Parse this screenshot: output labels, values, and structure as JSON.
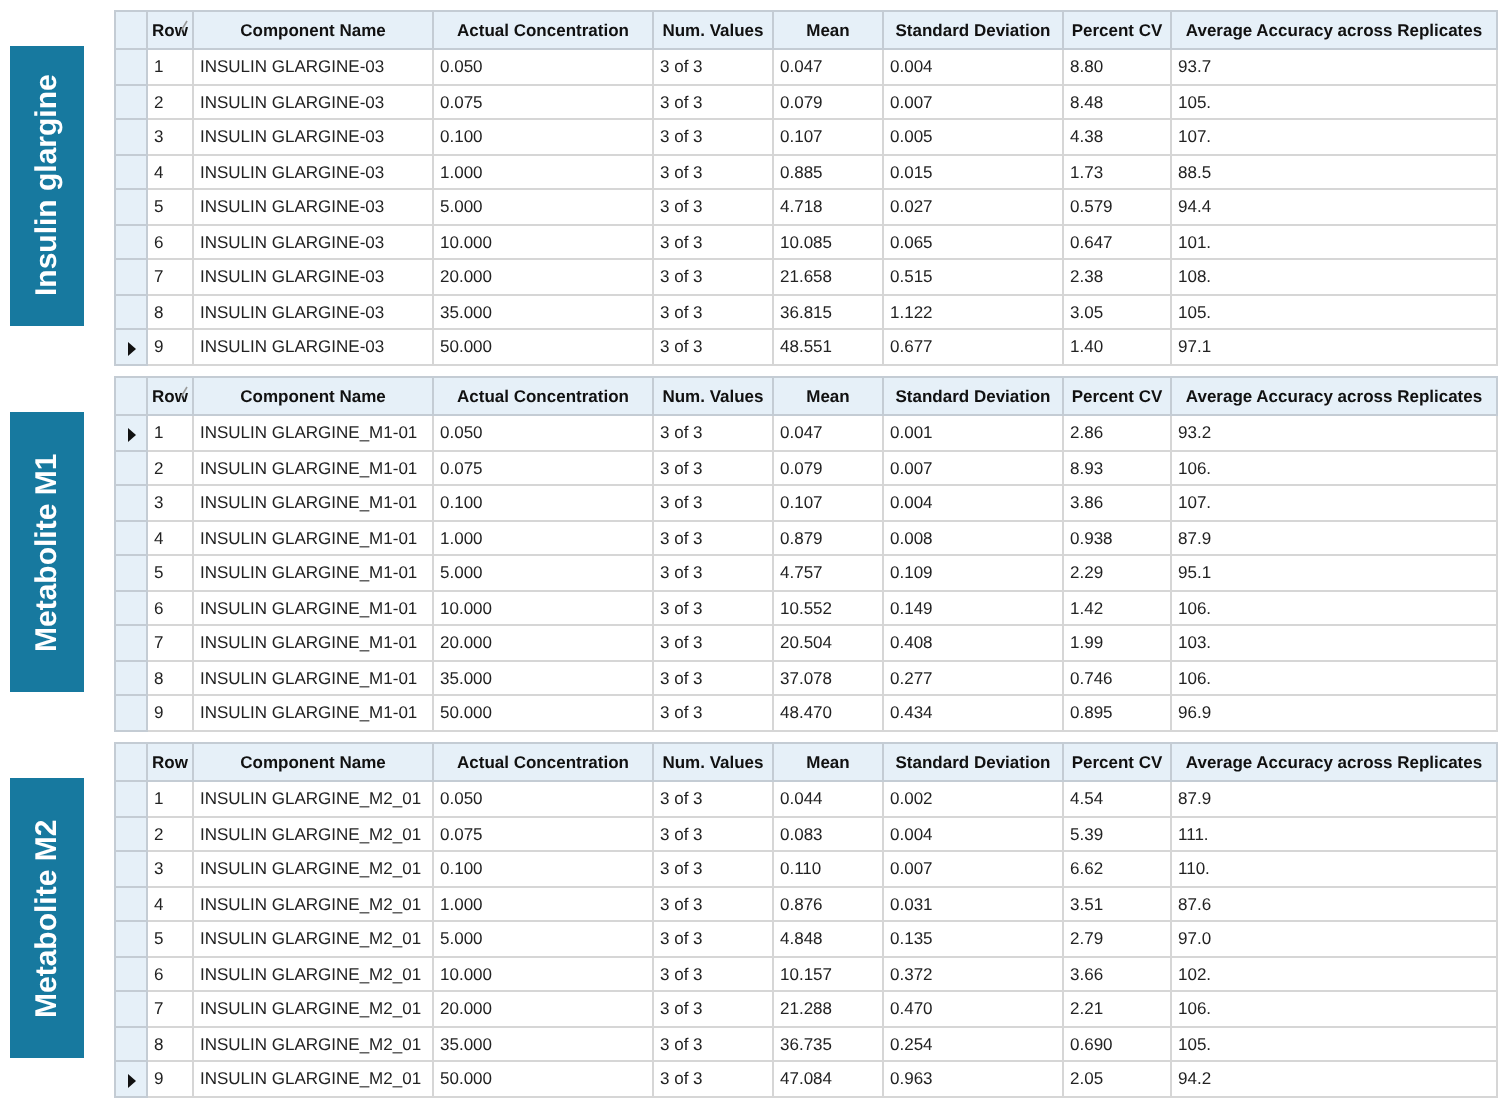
{
  "sections": [
    {
      "label": "Insulin glargine",
      "sorted": true,
      "columns": [
        "Row",
        "Component Name",
        "Actual Concentration",
        "Num. Values",
        "Mean",
        "Standard Deviation",
        "Percent CV",
        "Average Accuracy across Replicates"
      ],
      "rows": [
        {
          "current": false,
          "cells": [
            "1",
            "INSULIN GLARGINE-03",
            "0.050",
            "3 of 3",
            "0.047",
            "0.004",
            "8.80",
            "93.7"
          ]
        },
        {
          "current": false,
          "cells": [
            "2",
            "INSULIN GLARGINE-03",
            "0.075",
            "3 of 3",
            "0.079",
            "0.007",
            "8.48",
            "105."
          ]
        },
        {
          "current": false,
          "cells": [
            "3",
            "INSULIN GLARGINE-03",
            "0.100",
            "3 of 3",
            "0.107",
            "0.005",
            "4.38",
            "107."
          ]
        },
        {
          "current": false,
          "cells": [
            "4",
            "INSULIN GLARGINE-03",
            "1.000",
            "3 of 3",
            "0.885",
            "0.015",
            "1.73",
            "88.5"
          ]
        },
        {
          "current": false,
          "cells": [
            "5",
            "INSULIN GLARGINE-03",
            "5.000",
            "3 of 3",
            "4.718",
            "0.027",
            "0.579",
            "94.4"
          ]
        },
        {
          "current": false,
          "cells": [
            "6",
            "INSULIN GLARGINE-03",
            "10.000",
            "3 of 3",
            "10.085",
            "0.065",
            "0.647",
            "101."
          ]
        },
        {
          "current": false,
          "cells": [
            "7",
            "INSULIN GLARGINE-03",
            "20.000",
            "3 of 3",
            "21.658",
            "0.515",
            "2.38",
            "108."
          ]
        },
        {
          "current": false,
          "cells": [
            "8",
            "INSULIN GLARGINE-03",
            "35.000",
            "3 of 3",
            "36.815",
            "1.122",
            "3.05",
            "105."
          ]
        },
        {
          "current": true,
          "cells": [
            "9",
            "INSULIN GLARGINE-03",
            "50.000",
            "3 of 3",
            "48.551",
            "0.677",
            "1.40",
            "97.1"
          ]
        }
      ]
    },
    {
      "label": "Metabolite M1",
      "sorted": true,
      "columns": [
        "Row",
        "Component Name",
        "Actual Concentration",
        "Num. Values",
        "Mean",
        "Standard Deviation",
        "Percent CV",
        "Average Accuracy across Replicates"
      ],
      "rows": [
        {
          "current": true,
          "cells": [
            "1",
            "INSULIN GLARGINE_M1-01",
            "0.050",
            "3 of 3",
            "0.047",
            "0.001",
            "2.86",
            "93.2"
          ]
        },
        {
          "current": false,
          "cells": [
            "2",
            "INSULIN GLARGINE_M1-01",
            "0.075",
            "3 of 3",
            "0.079",
            "0.007",
            "8.93",
            "106."
          ]
        },
        {
          "current": false,
          "cells": [
            "3",
            "INSULIN GLARGINE_M1-01",
            "0.100",
            "3 of 3",
            "0.107",
            "0.004",
            "3.86",
            "107."
          ]
        },
        {
          "current": false,
          "cells": [
            "4",
            "INSULIN GLARGINE_M1-01",
            "1.000",
            "3 of 3",
            "0.879",
            "0.008",
            "0.938",
            "87.9"
          ]
        },
        {
          "current": false,
          "cells": [
            "5",
            "INSULIN GLARGINE_M1-01",
            "5.000",
            "3 of 3",
            "4.757",
            "0.109",
            "2.29",
            "95.1"
          ]
        },
        {
          "current": false,
          "cells": [
            "6",
            "INSULIN GLARGINE_M1-01",
            "10.000",
            "3 of 3",
            "10.552",
            "0.149",
            "1.42",
            "106."
          ]
        },
        {
          "current": false,
          "cells": [
            "7",
            "INSULIN GLARGINE_M1-01",
            "20.000",
            "3 of 3",
            "20.504",
            "0.408",
            "1.99",
            "103."
          ]
        },
        {
          "current": false,
          "cells": [
            "8",
            "INSULIN GLARGINE_M1-01",
            "35.000",
            "3 of 3",
            "37.078",
            "0.277",
            "0.746",
            "106."
          ]
        },
        {
          "current": false,
          "cells": [
            "9",
            "INSULIN GLARGINE_M1-01",
            "50.000",
            "3 of 3",
            "48.470",
            "0.434",
            "0.895",
            "96.9"
          ]
        }
      ]
    },
    {
      "label": "Metabolite M2",
      "sorted": false,
      "columns": [
        "Row",
        "Component Name",
        "Actual Concentration",
        "Num. Values",
        "Mean",
        "Standard Deviation",
        "Percent CV",
        "Average Accuracy across Replicates"
      ],
      "rows": [
        {
          "current": false,
          "cells": [
            "1",
            "INSULIN GLARGINE_M2_01",
            "0.050",
            "3 of 3",
            "0.044",
            "0.002",
            "4.54",
            "87.9"
          ]
        },
        {
          "current": false,
          "cells": [
            "2",
            "INSULIN GLARGINE_M2_01",
            "0.075",
            "3 of 3",
            "0.083",
            "0.004",
            "5.39",
            "111."
          ]
        },
        {
          "current": false,
          "cells": [
            "3",
            "INSULIN GLARGINE_M2_01",
            "0.100",
            "3 of 3",
            "0.110",
            "0.007",
            "6.62",
            "110."
          ]
        },
        {
          "current": false,
          "cells": [
            "4",
            "INSULIN GLARGINE_M2_01",
            "1.000",
            "3 of 3",
            "0.876",
            "0.031",
            "3.51",
            "87.6"
          ]
        },
        {
          "current": false,
          "cells": [
            "5",
            "INSULIN GLARGINE_M2_01",
            "5.000",
            "3 of 3",
            "4.848",
            "0.135",
            "2.79",
            "97.0"
          ]
        },
        {
          "current": false,
          "cells": [
            "6",
            "INSULIN GLARGINE_M2_01",
            "10.000",
            "3 of 3",
            "10.157",
            "0.372",
            "3.66",
            "102."
          ]
        },
        {
          "current": false,
          "cells": [
            "7",
            "INSULIN GLARGINE_M2_01",
            "20.000",
            "3 of 3",
            "21.288",
            "0.470",
            "2.21",
            "106."
          ]
        },
        {
          "current": false,
          "cells": [
            "8",
            "INSULIN GLARGINE_M2_01",
            "35.000",
            "3 of 3",
            "36.735",
            "0.254",
            "0.690",
            "105."
          ]
        },
        {
          "current": true,
          "cells": [
            "9",
            "INSULIN GLARGINE_M2_01",
            "50.000",
            "3 of 3",
            "47.084",
            "0.963",
            "2.05",
            "94.2"
          ]
        }
      ]
    }
  ]
}
